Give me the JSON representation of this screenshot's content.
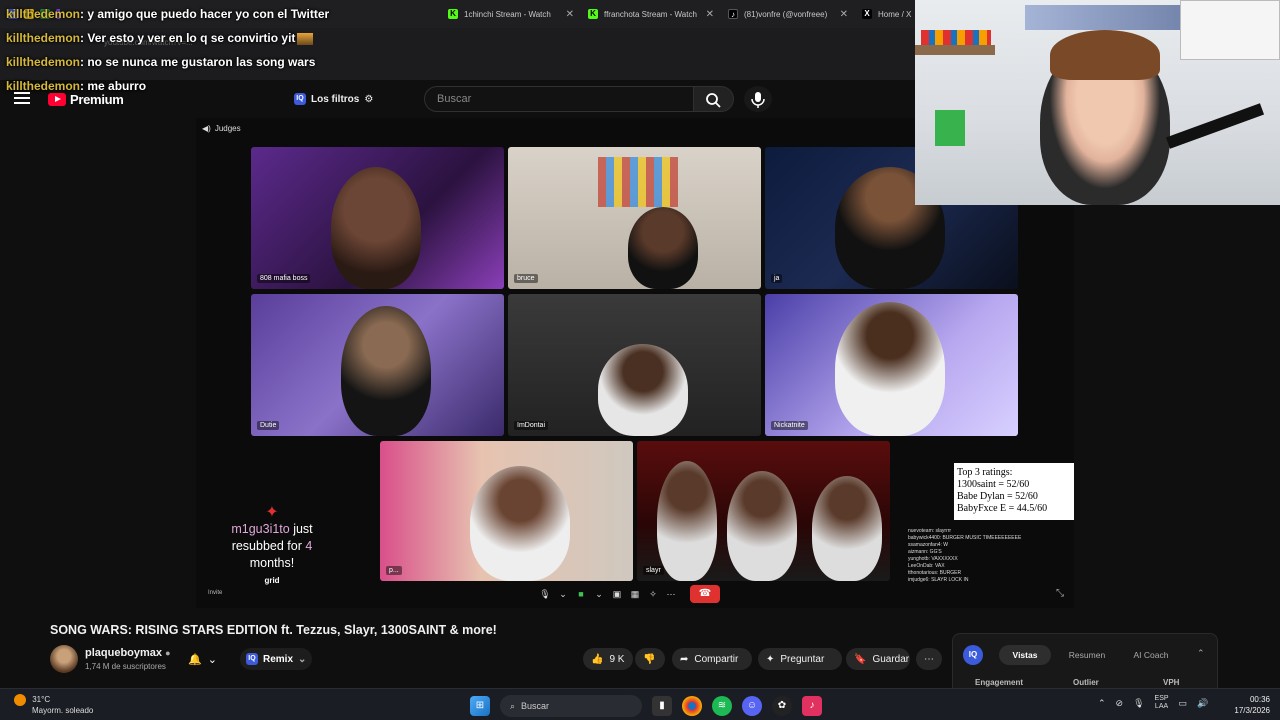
{
  "browser": {
    "tabs": [
      {
        "label": "1chinchi Stream - Watch",
        "icon": "kick-icon",
        "color": "#53fc18"
      },
      {
        "label": "ffranchota Stream - Watch",
        "icon": "kick-icon",
        "color": "#53fc18"
      },
      {
        "label": "(81)vonfre (@vonfreee)",
        "icon": "tiktok-icon",
        "color": "#ffffff"
      },
      {
        "label": "Home / X",
        "icon": "x-icon",
        "color": "#ffffff"
      }
    ],
    "url": "youtube.com/watch?v=..."
  },
  "stream_chat": [
    {
      "user": "killthedemon",
      "message": ": y amigo que puedo hacer yo con el Twitter"
    },
    {
      "user": "killthedemon",
      "message": ": Ver esto y ver en lo q se convirtio yit"
    },
    {
      "user": "killthedemon",
      "message": ": no se nunca me gustaron las song wars"
    },
    {
      "user": "killthedemon",
      "message": ": me aburro"
    }
  ],
  "youtube_header": {
    "logo": "Premium",
    "filters_label": "Los filtros",
    "iq_badge": "IQ",
    "search_placeholder": "Buscar"
  },
  "video": {
    "section_label": "Judges",
    "participants": [
      "808 mafia boss",
      "bruce",
      "ja",
      "Dutie",
      "ImDontai",
      "Nickatnite",
      "p...",
      "slayr"
    ],
    "sub_alert": {
      "user": "m1gu3i1to",
      "text_1": "just resubbed for",
      "months": "4",
      "text_2": "months!",
      "footer": "grid"
    },
    "ratings": {
      "title": "Top 3 ratings:",
      "lines": [
        "1300saint = 52/60",
        "Babe Dylan = 52/60",
        "BabyFxce E = 44.5/60"
      ]
    },
    "mini_chat": [
      "nuevoteam: slayrrrr",
      "babywick4400: BURGER MUSIC TIMEEEEEEEEE",
      "ssamazonfan4: W",
      "aizmann: GG'S",
      "yunghotb: VAXXXXXX",
      "LeeOnDab: VAX",
      "tthonotarious: BURGER",
      "imjudge6: SLAYR LOCK IN"
    ],
    "invite_label": "Invite"
  },
  "meta": {
    "title": "SONG WARS: RISING STARS EDITION ft. Tezzus, Slayr, 1300SAINT & more!",
    "channel": "plaqueboymax",
    "subscribers": "1,74 M de suscriptores",
    "remix_label": "Remix",
    "likes": "9 K",
    "share_label": "Compartir",
    "ask_label": "Preguntar",
    "save_label": "Guardar"
  },
  "iq_panel": {
    "badge": "IQ",
    "tabs": [
      "Vistas",
      "Resumen",
      "AI Coach"
    ],
    "active_tab": "Vistas",
    "columns": [
      "Engagement",
      "Outlier",
      "VPH"
    ]
  },
  "taskbar": {
    "temperature": "31°C",
    "weather": "Mayorm. soleado",
    "search_label": "Buscar",
    "lang_1": "ESP",
    "lang_2": "LAA",
    "time": "00:36",
    "date": "17/3/2026"
  }
}
